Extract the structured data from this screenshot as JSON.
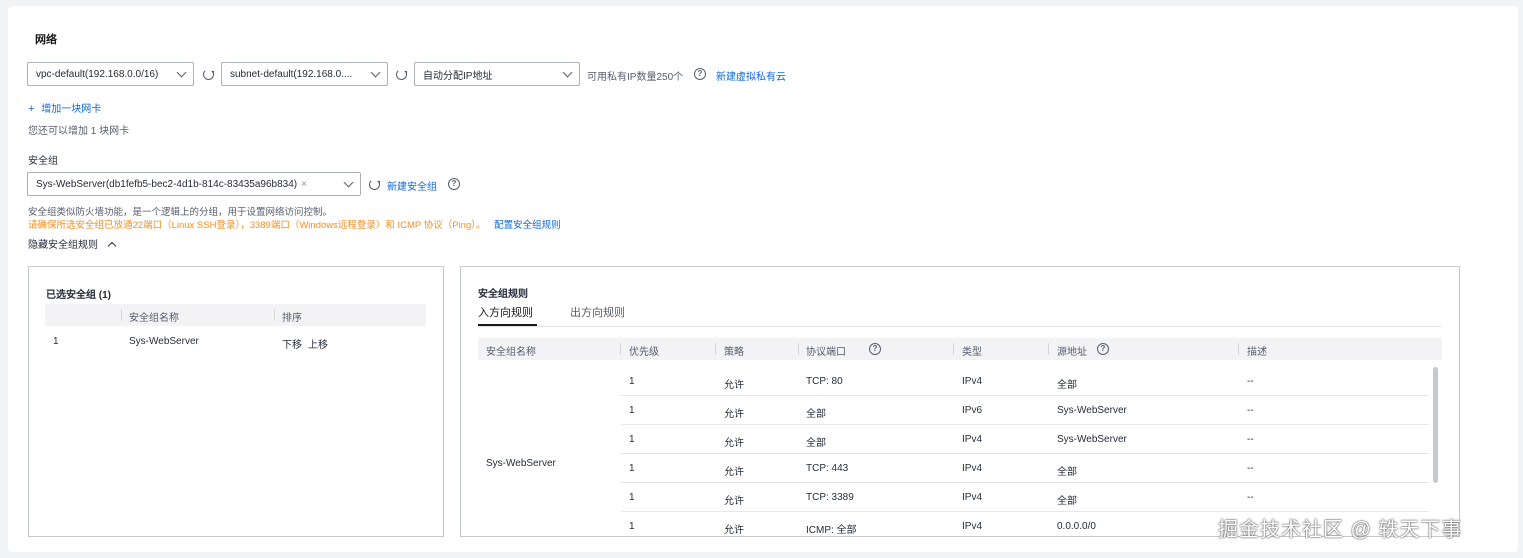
{
  "network": {
    "title": "网络",
    "vpc_select": "vpc-default(192.168.0.0/16)",
    "subnet_select": "subnet-default(192.168.0....",
    "ip_select": "自动分配IP地址",
    "available_ip": "可用私有IP数量250个",
    "new_vpc_link": "新建虚拟私有云",
    "add_nic": "增加一块网卡",
    "nic_hint": "您还可以增加 1 块网卡"
  },
  "security": {
    "label": "安全组",
    "selected_tag": "Sys-WebServer(db1fefb5-bec2-4d1b-814c-83435a96b834)",
    "new_sg_link": "新建安全组",
    "desc": "安全组类似防火墙功能，是一个逻辑上的分组，用于设置网络访问控制。",
    "warning": "请确保所选安全组已放通22端口（Linux SSH登录），3389端口（Windows远程登录）和 ICMP 协议（Ping）。",
    "config_link": "配置安全组规则",
    "hide_rules": "隐藏安全组规则"
  },
  "selected_panel": {
    "title": "已选安全组 (1)",
    "headers": [
      "安全组名称",
      "排序"
    ],
    "rows": [
      {
        "index": "1",
        "name": "Sys-WebServer",
        "down": "下移",
        "up": "上移"
      }
    ]
  },
  "rules_panel": {
    "title": "安全组规则",
    "tabs": [
      "入方向规则",
      "出方向规则"
    ],
    "headers": [
      "安全组名称",
      "优先级",
      "策略",
      "协议端口",
      "类型",
      "源地址",
      "描述"
    ],
    "group_name": "Sys-WebServer",
    "rows": [
      {
        "priority": "1",
        "policy": "允许",
        "port": "TCP: 80",
        "type": "IPv4",
        "source": "全部",
        "source_link": false,
        "desc": "--"
      },
      {
        "priority": "1",
        "policy": "允许",
        "port": "全部",
        "type": "IPv6",
        "source": "Sys-WebServer",
        "source_link": true,
        "desc": "--"
      },
      {
        "priority": "1",
        "policy": "允许",
        "port": "全部",
        "type": "IPv4",
        "source": "Sys-WebServer",
        "source_link": true,
        "desc": "--"
      },
      {
        "priority": "1",
        "policy": "允许",
        "port": "TCP: 443",
        "type": "IPv4",
        "source": "全部",
        "source_link": false,
        "desc": "--"
      },
      {
        "priority": "1",
        "policy": "允许",
        "port": "TCP: 3389",
        "type": "IPv4",
        "source": "全部",
        "source_link": false,
        "desc": "--"
      },
      {
        "priority": "1",
        "policy": "允许",
        "port": "ICMP: 全部",
        "type": "IPv4",
        "source": "0.0.0.0/0",
        "source_link": false,
        "desc": "--"
      }
    ]
  },
  "watermark": "掘金技术社区 @ 轶天下事"
}
